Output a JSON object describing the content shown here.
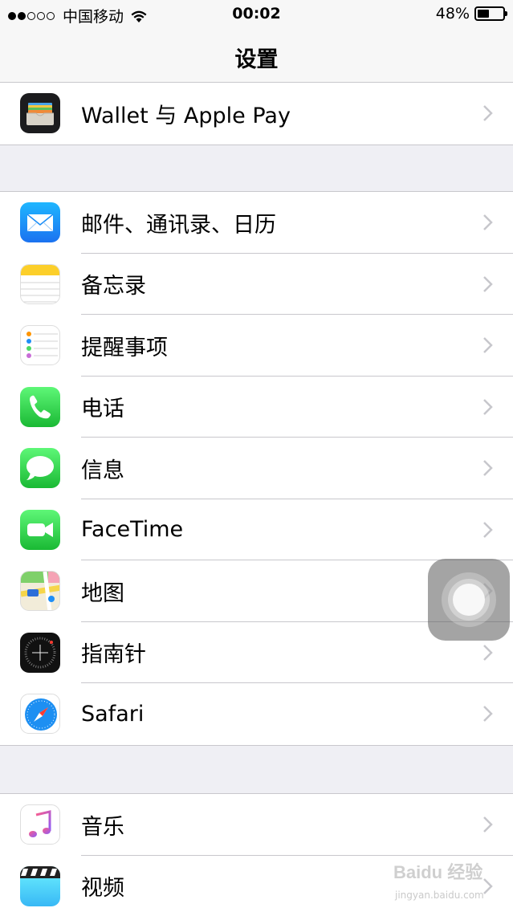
{
  "status_bar": {
    "carrier": "中国移动",
    "time": "00:02",
    "battery_percent": "48%",
    "battery_level": 0.48,
    "signal_bars_filled": 2,
    "signal_bars_total": 5
  },
  "nav": {
    "title": "设置"
  },
  "groups": [
    {
      "items": [
        {
          "label": "Wallet 与 Apple Pay",
          "icon": "wallet-icon"
        }
      ]
    },
    {
      "items": [
        {
          "label": "邮件、通讯录、日历",
          "icon": "mail-icon"
        },
        {
          "label": "备忘录",
          "icon": "notes-icon"
        },
        {
          "label": "提醒事项",
          "icon": "reminders-icon"
        },
        {
          "label": "电话",
          "icon": "phone-icon"
        },
        {
          "label": "信息",
          "icon": "messages-icon"
        },
        {
          "label": "FaceTime",
          "icon": "facetime-icon"
        },
        {
          "label": "地图",
          "icon": "maps-icon"
        },
        {
          "label": "指南针",
          "icon": "compass-icon"
        },
        {
          "label": "Safari",
          "icon": "safari-icon"
        }
      ]
    },
    {
      "items": [
        {
          "label": "音乐",
          "icon": "music-icon"
        },
        {
          "label": "视频",
          "icon": "videos-icon"
        }
      ]
    }
  ],
  "watermark": {
    "text": "jingyan.baidu.com",
    "logo_text": "Baidu 经验"
  },
  "colors": {
    "background": "#efeff4",
    "separator": "#c8c7cc",
    "chevron": "#c7c7cc",
    "mail": "#1e8ef7",
    "phone": "#2fc84a",
    "messages": "#2fc84a",
    "facetime": "#2fc84a",
    "music_bg": "#ffffff"
  }
}
